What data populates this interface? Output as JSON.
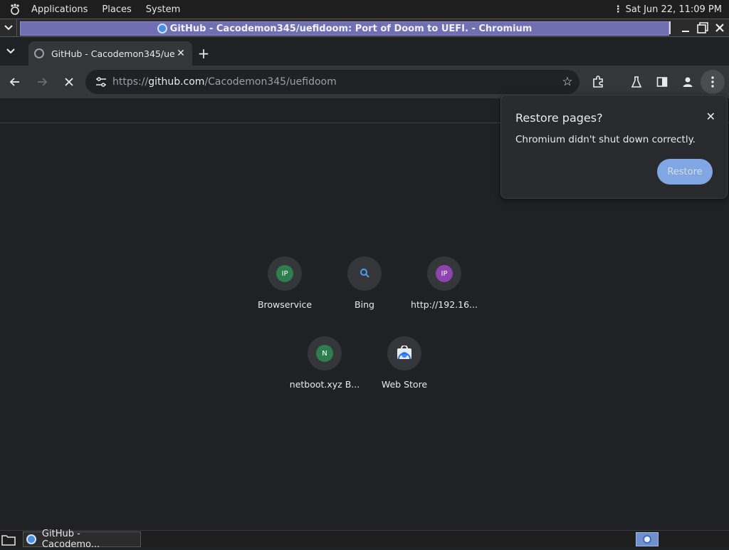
{
  "top_panel": {
    "menus": [
      "Applications",
      "Places",
      "System"
    ],
    "clock": "Sat Jun 22, 11:09 PM"
  },
  "window": {
    "title": "GitHub - Cacodemon345/uefidoom: Port of Doom to UEFI. - Chromium"
  },
  "tabs": [
    {
      "title": "GitHub - Cacodemon345/uefidoom"
    }
  ],
  "toolbar": {
    "url_scheme": "https://",
    "url_host": "github.com",
    "url_path": "/Cacodemon345/uefidoom"
  },
  "shortcuts": [
    {
      "label": "Browservice",
      "badge": "IP",
      "color": "#2e7d4f"
    },
    {
      "label": "Bing",
      "badge": "search-icon",
      "color": "#35363a"
    },
    {
      "label": "http://192.16...",
      "badge": "IP",
      "color": "#8e44ad"
    },
    {
      "label": "netboot.xyz B...",
      "badge": "N",
      "color": "#2e7d4f"
    },
    {
      "label": "Web Store",
      "badge": "webstore-icon",
      "color": "#35363a"
    }
  ],
  "popup": {
    "title": "Restore pages?",
    "message": "Chromium didn't shut down correctly.",
    "button": "Restore"
  },
  "taskbar": {
    "task_label": "GitHub - Cacodemo..."
  },
  "colors": {
    "accent": "#8ab4f8",
    "title_bar_active": "#6f6fb2",
    "background": "#202124"
  }
}
